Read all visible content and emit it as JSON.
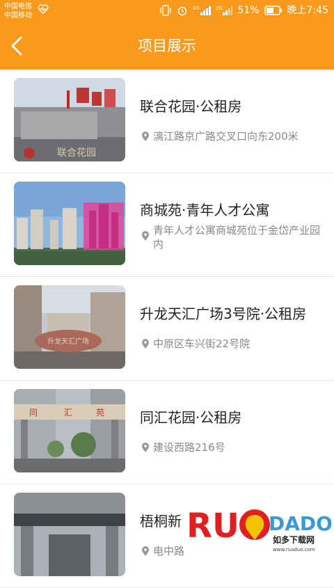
{
  "status_bar": {
    "carrier_1": "中国电信",
    "carrier_2": "中国移动",
    "battery": "51%",
    "time": "晚上7:45",
    "icons": [
      "heart-rate-icon",
      "vibrate-icon",
      "alarm-icon",
      "4g-signal-icon",
      "2g-signal-icon",
      "battery-icon"
    ]
  },
  "nav": {
    "title": "项目展示",
    "back_icon": "chevron-left-icon"
  },
  "colors": {
    "accent": "#f99a1c",
    "title_text": "#222222",
    "sub_text": "#888888",
    "divider": "#e6e6e6"
  },
  "items": [
    {
      "name": "联合花园·公租房",
      "address": "漓江路京广路交叉口向东200米"
    },
    {
      "name": "商城苑·青年人才公寓",
      "address": "青年人才公寓商城苑位于金岱产业园内"
    },
    {
      "name": "升龙天汇广场3号院·公租房",
      "address": "中原区车兴街22号院"
    },
    {
      "name": "同汇花园·公租房",
      "address": "建设西路216号"
    },
    {
      "name": "梧桐新",
      "address": "电中路"
    }
  ],
  "watermark": {
    "logo": "RUANDADO",
    "cn": "如多下载网",
    "url": "www.ruaduo.com"
  }
}
